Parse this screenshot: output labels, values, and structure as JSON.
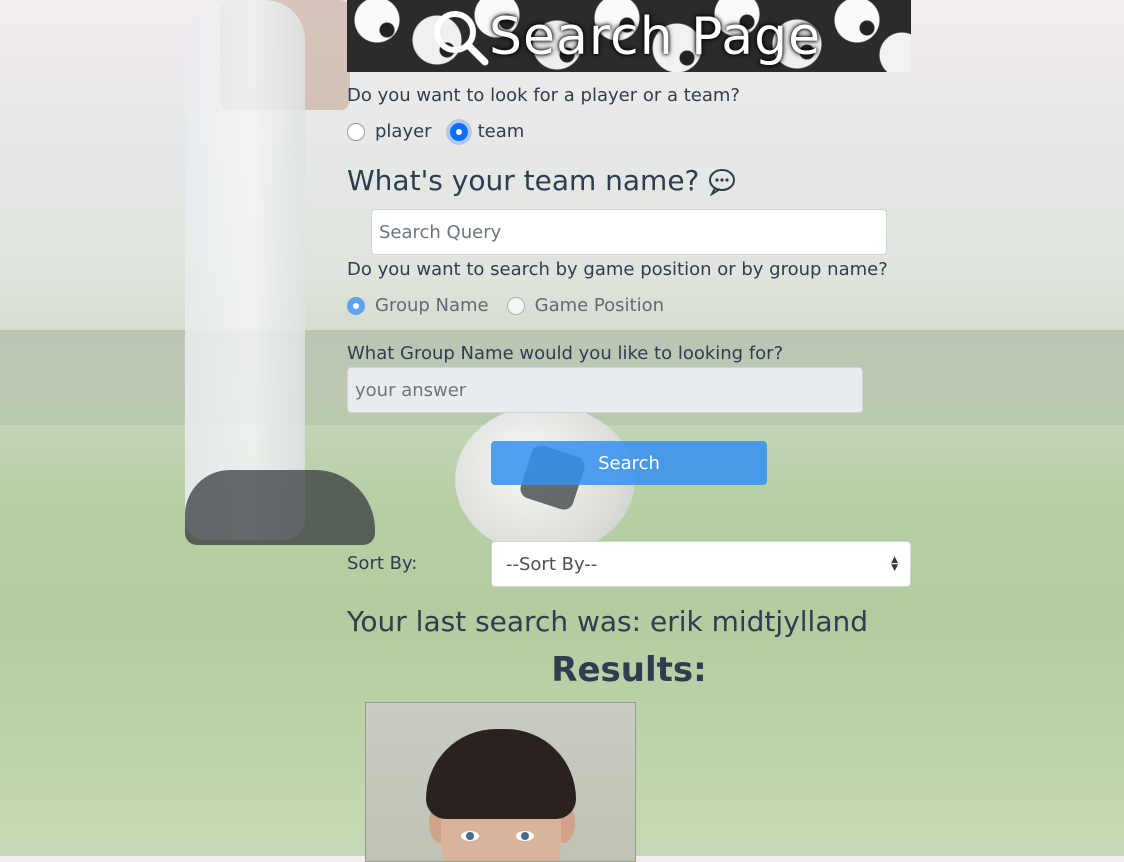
{
  "header": {
    "title": "Search Page"
  },
  "search_type": {
    "question": "Do you want to look for a player or a team?",
    "options": [
      {
        "label": "player",
        "checked": false
      },
      {
        "label": "team",
        "checked": true
      }
    ]
  },
  "team_name": {
    "heading": "What's your team name?",
    "placeholder": "Search Query"
  },
  "search_by": {
    "question": "Do you want to search by game position or by group name?",
    "options": [
      {
        "label": "Group Name",
        "checked": true
      },
      {
        "label": "Game Position",
        "checked": false
      }
    ]
  },
  "group_name": {
    "question": "What Group Name would you like to looking for?",
    "placeholder": "your answer"
  },
  "search_button": {
    "label": "Search"
  },
  "sort": {
    "label": "Sort By:",
    "selected": "--Sort By--"
  },
  "last_search": {
    "text": "Your last search was: erik midtjylland"
  },
  "results": {
    "title": "Results:"
  },
  "colors": {
    "primary": "#0d6efd",
    "button": "#3490f0",
    "text": "#2c3e50"
  }
}
